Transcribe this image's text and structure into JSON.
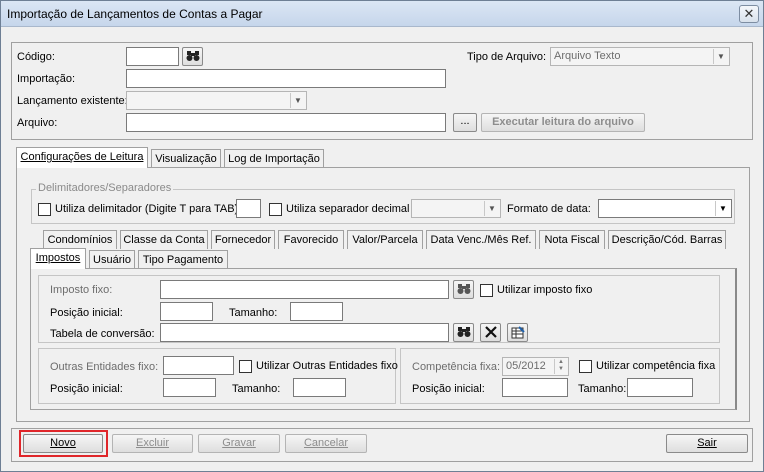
{
  "window": {
    "title": "Importação de Lançamentos de Contas a Pagar",
    "close_glyph": "✕"
  },
  "header": {
    "codigo_label": "Código:",
    "codigo_value": "",
    "importacao_label": "Importação:",
    "importacao_value": "",
    "lancamento_label": "Lançamento existente:",
    "lancamento_value": "",
    "arquivo_label": "Arquivo:",
    "arquivo_value": "",
    "browse_label": "...",
    "executar_label": "Executar leitura do arquivo",
    "tipo_label": "Tipo de Arquivo:",
    "tipo_value": "Arquivo Texto"
  },
  "main_tabs": [
    {
      "label": "Configurações de Leitura",
      "active": true
    },
    {
      "label": "Visualização",
      "active": false
    },
    {
      "label": "Log de Importação",
      "active": false
    }
  ],
  "delimitadores": {
    "group_title": "Delimitadores/Separadores",
    "utiliza_delim_label": "Utiliza delimitador (Digite T para TAB)",
    "delim_value": "",
    "utiliza_sep_label": "Utiliza separador decimal",
    "sep_value": "",
    "formato_label": "Formato de data:",
    "formato_value": ""
  },
  "sub_tabs_row1": [
    {
      "label": "Condomínios"
    },
    {
      "label": "Classe da Conta"
    },
    {
      "label": "Fornecedor"
    },
    {
      "label": "Favorecido"
    },
    {
      "label": "Valor/Parcela"
    },
    {
      "label": "Data Venc./Mês Ref."
    },
    {
      "label": "Nota Fiscal"
    },
    {
      "label": "Descrição/Cód. Barras"
    }
  ],
  "sub_tabs_row2": [
    {
      "label": "Impostos",
      "active": true
    },
    {
      "label": "Usuário",
      "active": false
    },
    {
      "label": "Tipo Pagamento",
      "active": false
    }
  ],
  "impostos": {
    "imposto_fixo_label": "Imposto fixo:",
    "imposto_fixo_value": "",
    "utilizar_imposto_label": "Utilizar imposto fixo",
    "posicao_label": "Posição inicial:",
    "posicao_value": "",
    "tamanho_label": "Tamanho:",
    "tamanho_value": "",
    "tabela_label": "Tabela de conversão:",
    "tabela_value": ""
  },
  "outras": {
    "fixo_label": "Outras Entidades fixo:",
    "fixo_value": "",
    "utilizar_label": "Utilizar Outras Entidades fixo",
    "posicao_label": "Posição inicial:",
    "posicao_value": "",
    "tamanho_label": "Tamanho:",
    "tamanho_value": ""
  },
  "competencia": {
    "fixa_label": "Competência fixa:",
    "fixa_value": "05/2012",
    "utilizar_label": "Utilizar competência fixa",
    "posicao_label": "Posição inicial:",
    "posicao_value": "",
    "tamanho_label": "Tamanho:",
    "tamanho_value": ""
  },
  "footer": {
    "novo_label": "Novo",
    "excluir_label": "Excluir",
    "gravar_label": "Gravar",
    "cancelar_label": "Cancelar",
    "sair_label": "Sair"
  },
  "colors": {
    "highlight": "#e0262a",
    "accent_blue": "#1f5fa8"
  }
}
